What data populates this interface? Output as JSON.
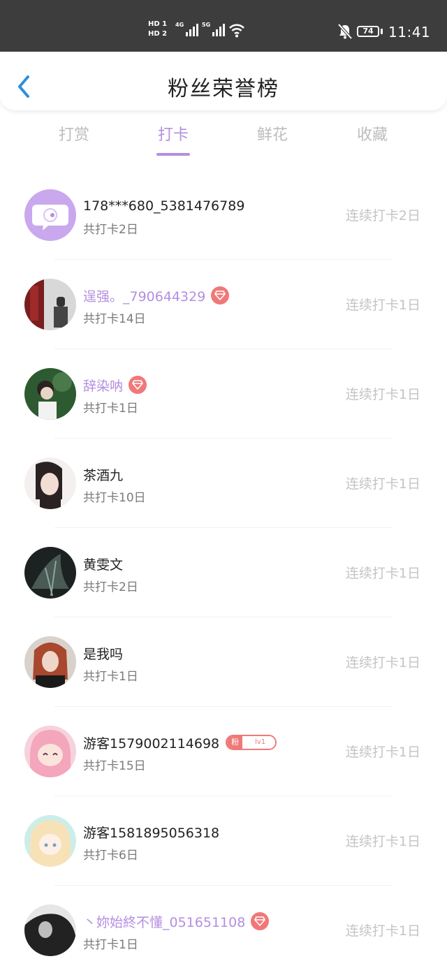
{
  "status_bar": {
    "hd1": "HD 1",
    "hd2": "HD 2",
    "net1": "4G",
    "net2": "5G",
    "battery": "74",
    "time": "11:41"
  },
  "header": {
    "title": "粉丝荣誉榜",
    "back_icon": "chevron-left-icon"
  },
  "tabs": [
    {
      "label": "打赏",
      "active": false
    },
    {
      "label": "打卡",
      "active": true
    },
    {
      "label": "鲜花",
      "active": false
    },
    {
      "label": "收藏",
      "active": false
    }
  ],
  "colors": {
    "accent": "#b58ee0",
    "badge": "#f07878",
    "muted": "#c4c4c4",
    "status_bar": "#3d3d3d"
  },
  "fans": [
    {
      "name": "178***680_5381476789",
      "total": "共打卡2日",
      "streak": "连续打卡2日",
      "vip": false,
      "badge": "none"
    },
    {
      "name": "逞强。_790644329",
      "total": "共打卡14日",
      "streak": "连续打卡1日",
      "vip": true,
      "badge": "gem"
    },
    {
      "name": "辞染呐",
      "total": "共打卡1日",
      "streak": "连续打卡1日",
      "vip": true,
      "badge": "gem"
    },
    {
      "name": "茶酒九",
      "total": "共打卡10日",
      "streak": "连续打卡1日",
      "vip": false,
      "badge": "none"
    },
    {
      "name": "黄雯文",
      "total": "共打卡2日",
      "streak": "连续打卡1日",
      "vip": false,
      "badge": "none"
    },
    {
      "name": "是我吗",
      "total": "共打卡1日",
      "streak": "连续打卡1日",
      "vip": false,
      "badge": "none"
    },
    {
      "name": "游客1579002114698",
      "total": "共打卡15日",
      "streak": "连续打卡1日",
      "vip": false,
      "badge": "fan",
      "fan_badge": {
        "label": "粉",
        "level": "lv1"
      }
    },
    {
      "name": "游客1581895056318",
      "total": "共打卡6日",
      "streak": "连续打卡1日",
      "vip": false,
      "badge": "none"
    },
    {
      "name": "丶妳始終不懂_051651108",
      "total": "共打卡1日",
      "streak": "连续打卡1日",
      "vip": true,
      "badge": "gem"
    }
  ]
}
